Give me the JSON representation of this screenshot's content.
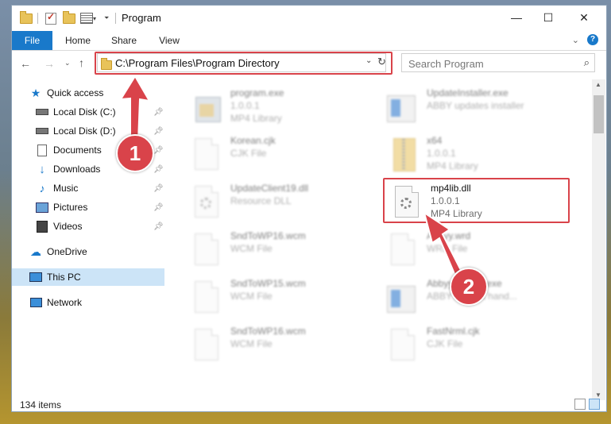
{
  "window": {
    "title": "Program",
    "controls": {
      "minimize": "—",
      "maximize": "☐",
      "close": "✕"
    }
  },
  "ribbon": {
    "tabs": [
      "File",
      "Home",
      "Share",
      "View"
    ],
    "expand_icon": "chevron-down-icon",
    "help_label": "?"
  },
  "address_bar": {
    "path": "C:\\Program Files\\Program Directory"
  },
  "search": {
    "placeholder": "Search Program"
  },
  "nav_pane": {
    "items": [
      {
        "label": "Quick access",
        "icon": "star-icon",
        "pinned": false
      },
      {
        "label": "Local Disk (C:)",
        "icon": "drive-icon",
        "pinned": true
      },
      {
        "label": "Local Disk (D:)",
        "icon": "drive-icon",
        "pinned": true
      },
      {
        "label": "Documents",
        "icon": "document-icon",
        "pinned": true
      },
      {
        "label": "Downloads",
        "icon": "download-icon",
        "pinned": true
      },
      {
        "label": "Music",
        "icon": "music-icon",
        "pinned": true
      },
      {
        "label": "Pictures",
        "icon": "picture-icon",
        "pinned": true
      },
      {
        "label": "Videos",
        "icon": "video-icon",
        "pinned": true
      },
      {
        "label": "OneDrive",
        "icon": "cloud-icon",
        "pinned": false
      },
      {
        "label": "This PC",
        "icon": "computer-icon",
        "pinned": false,
        "selected": true
      },
      {
        "label": "Network",
        "icon": "network-icon",
        "pinned": false
      }
    ]
  },
  "files": [
    {
      "name": "program.exe",
      "line2": "1.0.0.1",
      "line3": "MP4 Library",
      "icon": "program-icon"
    },
    {
      "name": "UpdateInstaller.exe",
      "line2": "ABBY updates installer",
      "line3": "",
      "icon": "exe-icon"
    },
    {
      "name": "Korean.cjk",
      "line2": "CJK File",
      "line3": "",
      "icon": "file-icon"
    },
    {
      "name": "x64",
      "line2": "1.0.0.1",
      "line3": "MP4 Library",
      "icon": "zip-folder-icon"
    },
    {
      "name": "UpdateClient19.dll",
      "line2": "Resource DLL",
      "line3": "",
      "icon": "dll-icon"
    },
    {
      "name": "mp4lib.dll",
      "line2": "1.0.0.1",
      "line3": "MP4 Library",
      "icon": "dll-icon",
      "highlighted": true
    },
    {
      "name": "SndToWP16.wcm",
      "line2": "WCM File",
      "line3": "",
      "icon": "file-icon"
    },
    {
      "name": "Abbyy.wrd",
      "line2": "WRD File",
      "line3": "",
      "icon": "file-icon"
    },
    {
      "name": "SndToWP15.wcm",
      "line2": "WCM File",
      "line3": "",
      "icon": "file-icon"
    },
    {
      "name": "AbbyyUpdate.exe",
      "line2": "ABBYY Client hand...",
      "line3": "",
      "icon": "exe-icon"
    },
    {
      "name": "SndToWP16.wcm",
      "line2": "WCM File",
      "line3": "",
      "icon": "file-icon"
    },
    {
      "name": "FastNrml.cjk",
      "line2": "CJK File",
      "line3": "",
      "icon": "file-icon"
    }
  ],
  "status": {
    "item_count": "134 items"
  },
  "annotations": {
    "step1": "1",
    "step2": "2",
    "arrow_color": "#d9434a"
  }
}
